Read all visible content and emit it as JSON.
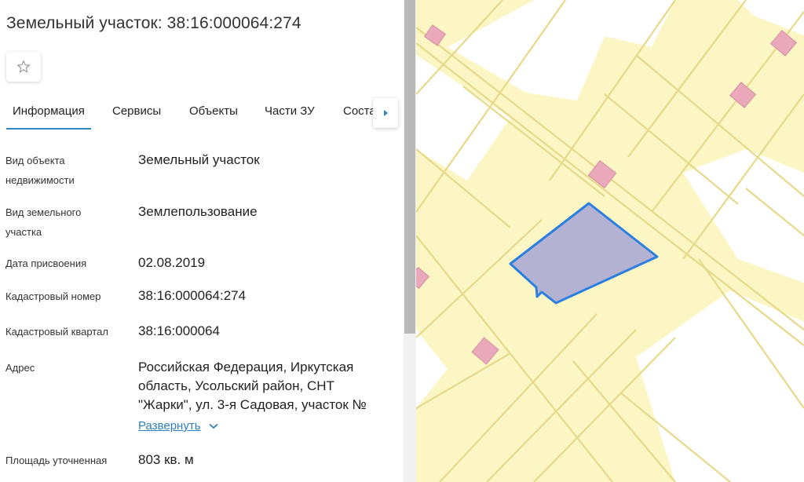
{
  "header": {
    "title": "Земельный участок: 38:16:000064:274",
    "favorite_icon": "star-icon"
  },
  "tabs": [
    {
      "label": "Информация",
      "active": true
    },
    {
      "label": "Сервисы",
      "active": false
    },
    {
      "label": "Объекты",
      "active": false
    },
    {
      "label": "Части ЗУ",
      "active": false
    },
    {
      "label": "Состав",
      "active": false
    }
  ],
  "tabs_next_icon": "caret-right-icon",
  "info": {
    "object_type": {
      "label1": "Вид объекта",
      "label2": "недвижимости",
      "value": "Земельный участок"
    },
    "land_type": {
      "label1": "Вид земельного",
      "label2": "участка",
      "value": "Землепользование"
    },
    "date_assigned": {
      "label": "Дата присвоения",
      "value": "02.08.2019"
    },
    "cadastral_number": {
      "label": "Кадастровый номер",
      "value": "38:16:000064:274"
    },
    "cadastral_quarter": {
      "label": "Кадастровый квартал",
      "value": "38:16:000064"
    },
    "address": {
      "label": "Адрес",
      "line1": "Российская Федерация, Иркутская",
      "line2": "область, Усольский район, СНТ",
      "line3": "\"Жарки\", ул. 3-я Садовая, участок №",
      "expand_label": "Развернуть",
      "expand_icon": "chevron-down-icon"
    },
    "area": {
      "label": "Площадь уточненная",
      "value": "803 кв. м"
    }
  },
  "map": {
    "background_color": "#fbf6c4",
    "parcel_line_color": "#e8dd8a",
    "building_color": "#e9a9bb",
    "selected_fill": "#a7a6d6",
    "selected_stroke": "#2a7fe0"
  }
}
